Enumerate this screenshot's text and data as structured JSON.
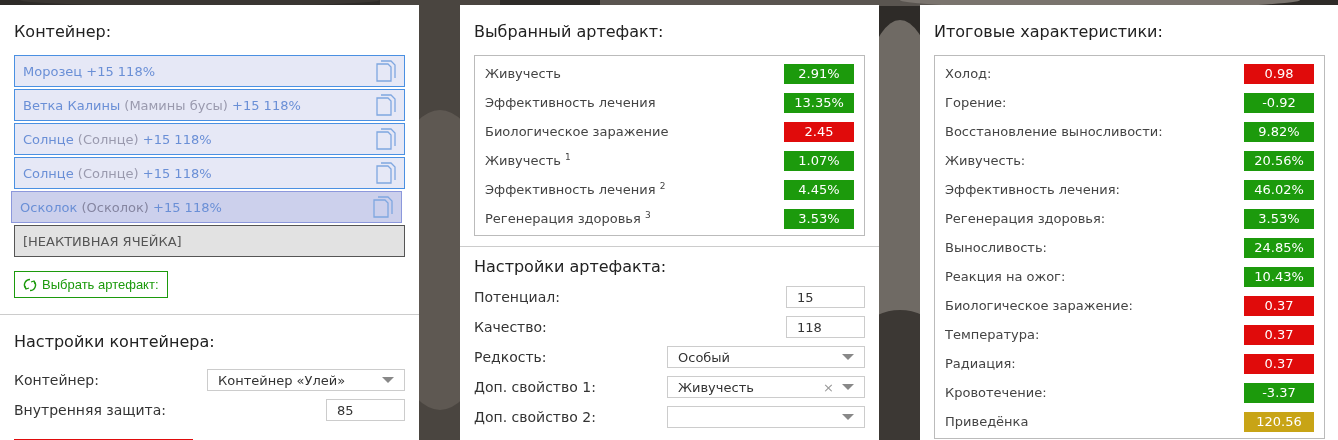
{
  "container_panel": {
    "title": "Контейнер:",
    "slots": [
      {
        "kind": "artifact",
        "name": "Морозец",
        "suffix": "+15 118%",
        "selected": false
      },
      {
        "kind": "artifact",
        "name": "Ветка Калины",
        "variant": "(Мамины бусы)",
        "suffix": "+15 118%",
        "selected": false
      },
      {
        "kind": "artifact",
        "name": "Солнце",
        "variant": "(Солнце)",
        "suffix": "+15 118%",
        "selected": false
      },
      {
        "kind": "artifact",
        "name": "Солнце",
        "variant": "(Солнце)",
        "suffix": "+15 118%",
        "selected": false
      },
      {
        "kind": "artifact",
        "name": "Осколок",
        "variant": "(Осколок)",
        "suffix": "+15 118%",
        "selected": true
      },
      {
        "kind": "inactive",
        "name": "[НЕАКТИВНАЯ ЯЧЕЙКА]",
        "selected": false
      }
    ],
    "select_button": "Выбрать артефакт:",
    "settings_title": "Настройки контейнера:",
    "settings": [
      {
        "kind": "select",
        "label": "Контейнер:",
        "value": "Контейнер «Улей»"
      },
      {
        "kind": "input",
        "label": "Внутренняя защита:",
        "value": "85"
      }
    ]
  },
  "artifact_panel": {
    "title": "Выбранный артефакт:",
    "stats": [
      {
        "label": "Живучесть",
        "value": "2.91%",
        "color": "#1c9a0c"
      },
      {
        "label": "Эффективность лечения",
        "value": "13.35%",
        "color": "#1c9a0c"
      },
      {
        "label": "Биологическое заражение",
        "value": "2.45",
        "color": "#e00b0b"
      },
      {
        "label": "Живучесть $^{1}$",
        "value": "1.07%",
        "color": "#1c9a0c"
      },
      {
        "label": "Эффективность лечения $^{2}$",
        "value": "4.45%",
        "color": "#1c9a0c"
      },
      {
        "label": "Регенерация здоровья $^{3}$",
        "value": "3.53%",
        "color": "#1c9a0c"
      }
    ],
    "settings_title": "Настройки артефакта:",
    "settings": [
      {
        "kind": "input",
        "label": "Потенциал:",
        "value": "15"
      },
      {
        "kind": "input",
        "label": "Качество:",
        "value": "118"
      },
      {
        "kind": "select",
        "label": "Редкость:",
        "value": "Особый"
      },
      {
        "kind": "select",
        "label": "Доп. свойство 1:",
        "value": "Живучесть",
        "clear_icon": "×"
      },
      {
        "kind": "select",
        "label": "Доп. свойство 2:"
      }
    ]
  },
  "totals_panel": {
    "title": "Итоговые характеристики:",
    "stats": [
      {
        "label": "Холод:",
        "value": "0.98",
        "color": "#e00b0b"
      },
      {
        "label": "Горение:",
        "value": "-0.92",
        "color": "#1c9a0c"
      },
      {
        "label": "Восстановление выносливости:",
        "value": "9.82%",
        "color": "#1c9a0c"
      },
      {
        "label": "Живучесть:",
        "value": "20.56%",
        "color": "#1c9a0c"
      },
      {
        "label": "Эффективность лечения:",
        "value": "46.02%",
        "color": "#1c9a0c"
      },
      {
        "label": "Регенерация здоровья:",
        "value": "3.53%",
        "color": "#1c9a0c"
      },
      {
        "label": "Выносливость:",
        "value": "24.85%",
        "color": "#1c9a0c"
      },
      {
        "label": "Реакция на ожог:",
        "value": "10.43%",
        "color": "#1c9a0c"
      },
      {
        "label": "Биологическое заражение:",
        "value": "0.37",
        "color": "#e00b0b"
      },
      {
        "label": "Температура:",
        "value": "0.37",
        "color": "#e00b0b"
      },
      {
        "label": "Радиация:",
        "value": "0.37",
        "color": "#e00b0b"
      },
      {
        "label": "Кровотечение:",
        "value": "-3.37",
        "color": "#1c9a0c"
      },
      {
        "label": "Приведёнка",
        "value": "120.56",
        "color": "#c8a416"
      }
    ]
  }
}
